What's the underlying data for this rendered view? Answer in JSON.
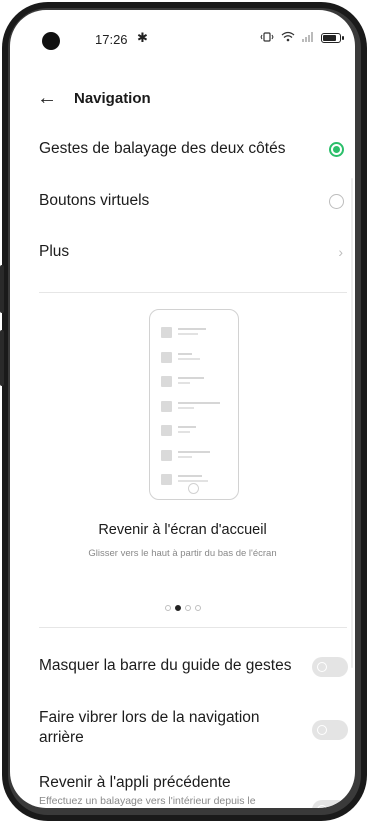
{
  "status_bar": {
    "time": "17:26",
    "settings_icon": "gear-icon",
    "icons": [
      "vibrate-icon",
      "wifi-icon",
      "signal-icon",
      "battery-icon"
    ]
  },
  "header": {
    "back_icon": "arrow-left-icon",
    "title": "Navigation"
  },
  "options": [
    {
      "label": "Gestes de balayage des deux côtés",
      "control": "radio",
      "selected": true
    },
    {
      "label": "Boutons virtuels",
      "control": "radio",
      "selected": false
    },
    {
      "label": "Plus",
      "control": "chevron"
    }
  ],
  "illustration": {
    "title": "Revenir à l'écran d'accueil",
    "subtitle": "Glisser vers le haut à partir du bas de l'écran",
    "pager": {
      "count": 4,
      "active_index": 1
    }
  },
  "settings": [
    {
      "label": "Masquer la barre du guide de gestes",
      "enabled": false
    },
    {
      "label": "Faire vibrer lors de la navigation arrière",
      "enabled": false
    },
    {
      "label": "Revenir à l'appli précédente",
      "description": "Effectuez un balayage vers l'intérieur depuis le",
      "enabled": false
    }
  ],
  "colors": {
    "accent": "#2bbf6a",
    "toggle_off": "#e4e4e4"
  }
}
